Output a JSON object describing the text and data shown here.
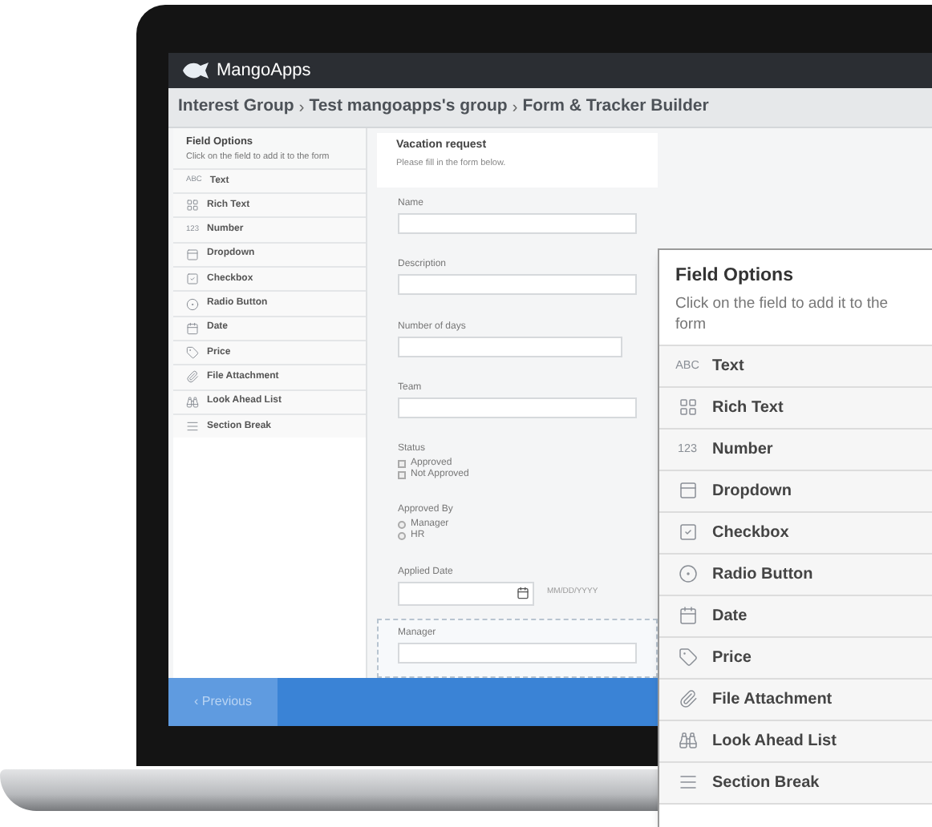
{
  "header": {
    "logo_text": "MangoApps"
  },
  "breadcrumb": {
    "separator": "›",
    "items": [
      "Interest Group",
      "Test mangoapps's group",
      "Form & Tracker Builder"
    ]
  },
  "sidebar": {
    "title": "Field Options",
    "hint": "Click on the field to add it to the form",
    "items": [
      {
        "kind": "text",
        "icon_text": "ABC",
        "label": "Text"
      },
      {
        "kind": "rich_text",
        "label": "Rich Text"
      },
      {
        "kind": "text",
        "icon_text": "123",
        "label": "Number"
      },
      {
        "kind": "dropdown",
        "label": "Dropdown"
      },
      {
        "kind": "checkbox",
        "label": "Checkbox"
      },
      {
        "kind": "radio",
        "label": "Radio Button"
      },
      {
        "kind": "date",
        "label": "Date"
      },
      {
        "kind": "price",
        "label": "Price"
      },
      {
        "kind": "file",
        "label": "File Attachment"
      },
      {
        "kind": "lookahead",
        "label": "Look Ahead List"
      },
      {
        "kind": "section",
        "label": "Section Break"
      }
    ]
  },
  "form": {
    "title": "Vacation request",
    "subtitle": "Please fill in the form below.",
    "fields": [
      {
        "kind": "text",
        "label": "Name",
        "selected": false
      },
      {
        "kind": "text",
        "label": "Description",
        "selected": false
      },
      {
        "kind": "number",
        "label": "Number of days",
        "selected": false
      },
      {
        "kind": "text",
        "label": "Team",
        "selected": false
      },
      {
        "kind": "checkbox",
        "label": "Status",
        "options": [
          {
            "label": "Approved",
            "checked": false
          },
          {
            "label": "Not Approved",
            "checked": false
          }
        ],
        "selected": false
      },
      {
        "kind": "radio",
        "label": "Approved By",
        "options": [
          {
            "label": "Manager",
            "checked": false
          },
          {
            "label": "HR",
            "checked": false
          }
        ],
        "selected": false
      },
      {
        "kind": "date",
        "label": "Applied Date",
        "hint": "MM/DD/YYYY",
        "selected": false
      },
      {
        "kind": "text",
        "label": "Manager",
        "selected": true
      }
    ]
  },
  "footer": {
    "previous": "‹ Previous"
  },
  "zoom_panel": {
    "title": "Field Options",
    "hint": "Click on the field to add it to the form",
    "items": [
      {
        "kind": "text",
        "icon_text": "ABC",
        "label": "Text"
      },
      {
        "kind": "rich_text",
        "label": "Rich Text"
      },
      {
        "kind": "text",
        "icon_text": "123",
        "label": "Number"
      },
      {
        "kind": "dropdown",
        "label": "Dropdown"
      },
      {
        "kind": "checkbox",
        "label": "Checkbox"
      },
      {
        "kind": "radio",
        "label": "Radio Button"
      },
      {
        "kind": "date",
        "label": "Date"
      },
      {
        "kind": "price",
        "label": "Price"
      },
      {
        "kind": "file",
        "label": "File Attachment"
      },
      {
        "kind": "lookahead",
        "label": "Look Ahead List"
      },
      {
        "kind": "section",
        "label": "Section Break"
      }
    ]
  }
}
